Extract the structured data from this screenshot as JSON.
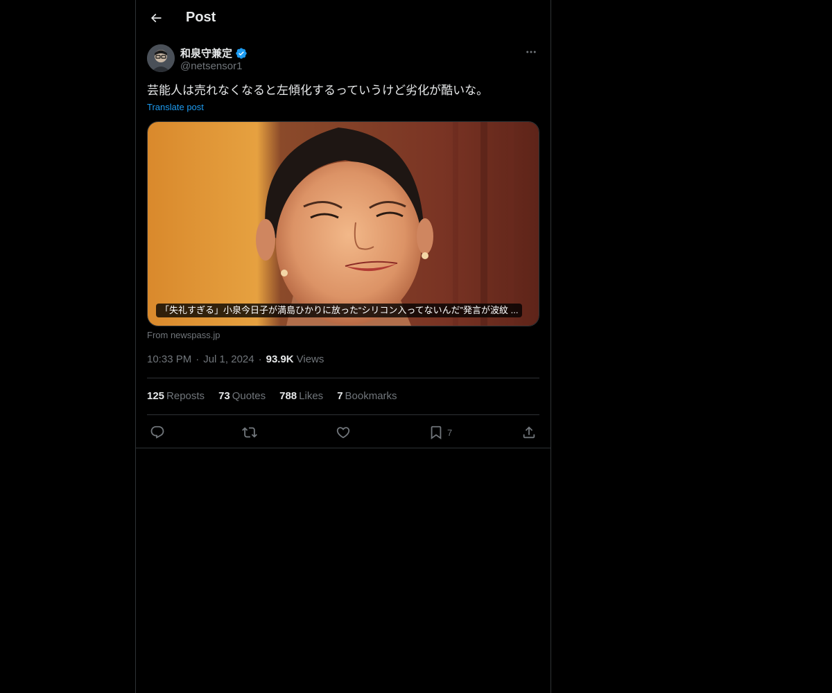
{
  "header": {
    "title": "Post",
    "back_icon": "arrow-left-icon"
  },
  "post": {
    "author": {
      "name": "和泉守兼定",
      "handle": "@netsensor1",
      "verified_icon": "verified-badge-icon"
    },
    "text": "芸能人は売れなくなると左傾化するっていうけど劣化が酷いな。",
    "translate_label": "Translate post",
    "card": {
      "caption": "「失礼すぎる」小泉今日子が満島ひかりに放った“シリコン入ってないんだ”発言が波紋 ...",
      "source": "From newspass.jp"
    },
    "meta": {
      "time": "10:33 PM",
      "date": "Jul 1, 2024",
      "views_count": "93.9K",
      "views_label": "Views"
    },
    "stats": [
      {
        "count": "125",
        "label": "Reposts"
      },
      {
        "count": "73",
        "label": "Quotes"
      },
      {
        "count": "788",
        "label": "Likes"
      },
      {
        "count": "7",
        "label": "Bookmarks"
      }
    ],
    "actions": {
      "reply_icon": "reply-icon",
      "repost_icon": "repost-icon",
      "like_icon": "heart-icon",
      "bookmark_icon": "bookmark-icon",
      "bookmark_count": "7",
      "share_icon": "share-icon"
    }
  },
  "colors": {
    "background": "#000000",
    "text_primary": "#e7e9ea",
    "text_secondary": "#71767b",
    "accent": "#1d9bf0",
    "border": "#2f3336"
  }
}
